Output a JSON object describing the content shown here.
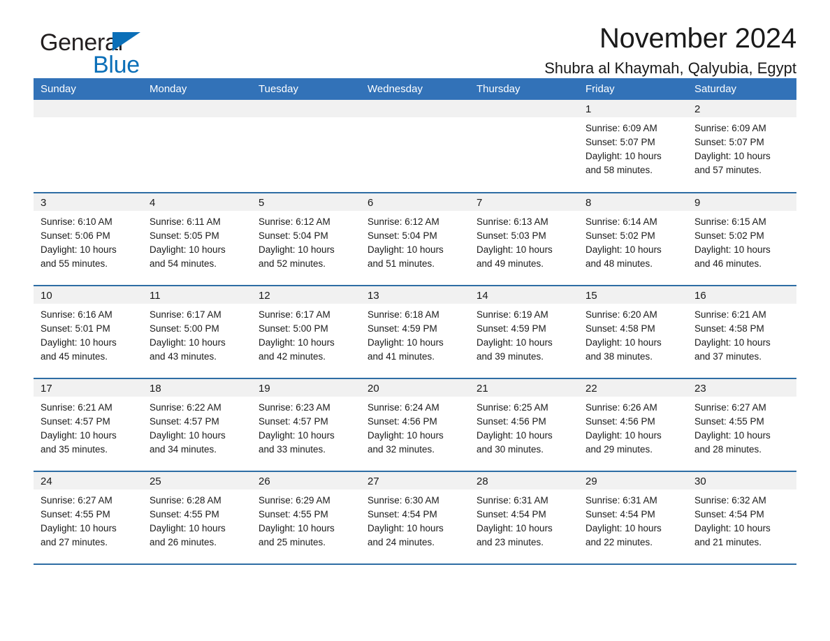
{
  "brand": {
    "word1": "General",
    "word2": "Blue",
    "triangle_color": "#0b6fb8"
  },
  "header": {
    "title": "November 2024",
    "subtitle": "Shubra al Khaymah, Qalyubia, Egypt"
  },
  "theme": {
    "header_blue": "#3272b8",
    "row_divider_blue": "#2e6da4",
    "daynum_band": "#f1f1f1",
    "text": "#1a1a1a"
  },
  "weekdays": [
    "Sunday",
    "Monday",
    "Tuesday",
    "Wednesday",
    "Thursday",
    "Friday",
    "Saturday"
  ],
  "weeks": [
    [
      {
        "day": "",
        "lines": []
      },
      {
        "day": "",
        "lines": []
      },
      {
        "day": "",
        "lines": []
      },
      {
        "day": "",
        "lines": []
      },
      {
        "day": "",
        "lines": []
      },
      {
        "day": "1",
        "sunrise": "Sunrise: 6:09 AM",
        "sunset": "Sunset: 5:07 PM",
        "daylight": "Daylight: 10 hours and 58 minutes."
      },
      {
        "day": "2",
        "sunrise": "Sunrise: 6:09 AM",
        "sunset": "Sunset: 5:07 PM",
        "daylight": "Daylight: 10 hours and 57 minutes."
      }
    ],
    [
      {
        "day": "3",
        "sunrise": "Sunrise: 6:10 AM",
        "sunset": "Sunset: 5:06 PM",
        "daylight": "Daylight: 10 hours and 55 minutes."
      },
      {
        "day": "4",
        "sunrise": "Sunrise: 6:11 AM",
        "sunset": "Sunset: 5:05 PM",
        "daylight": "Daylight: 10 hours and 54 minutes."
      },
      {
        "day": "5",
        "sunrise": "Sunrise: 6:12 AM",
        "sunset": "Sunset: 5:04 PM",
        "daylight": "Daylight: 10 hours and 52 minutes."
      },
      {
        "day": "6",
        "sunrise": "Sunrise: 6:12 AM",
        "sunset": "Sunset: 5:04 PM",
        "daylight": "Daylight: 10 hours and 51 minutes."
      },
      {
        "day": "7",
        "sunrise": "Sunrise: 6:13 AM",
        "sunset": "Sunset: 5:03 PM",
        "daylight": "Daylight: 10 hours and 49 minutes."
      },
      {
        "day": "8",
        "sunrise": "Sunrise: 6:14 AM",
        "sunset": "Sunset: 5:02 PM",
        "daylight": "Daylight: 10 hours and 48 minutes."
      },
      {
        "day": "9",
        "sunrise": "Sunrise: 6:15 AM",
        "sunset": "Sunset: 5:02 PM",
        "daylight": "Daylight: 10 hours and 46 minutes."
      }
    ],
    [
      {
        "day": "10",
        "sunrise": "Sunrise: 6:16 AM",
        "sunset": "Sunset: 5:01 PM",
        "daylight": "Daylight: 10 hours and 45 minutes."
      },
      {
        "day": "11",
        "sunrise": "Sunrise: 6:17 AM",
        "sunset": "Sunset: 5:00 PM",
        "daylight": "Daylight: 10 hours and 43 minutes."
      },
      {
        "day": "12",
        "sunrise": "Sunrise: 6:17 AM",
        "sunset": "Sunset: 5:00 PM",
        "daylight": "Daylight: 10 hours and 42 minutes."
      },
      {
        "day": "13",
        "sunrise": "Sunrise: 6:18 AM",
        "sunset": "Sunset: 4:59 PM",
        "daylight": "Daylight: 10 hours and 41 minutes."
      },
      {
        "day": "14",
        "sunrise": "Sunrise: 6:19 AM",
        "sunset": "Sunset: 4:59 PM",
        "daylight": "Daylight: 10 hours and 39 minutes."
      },
      {
        "day": "15",
        "sunrise": "Sunrise: 6:20 AM",
        "sunset": "Sunset: 4:58 PM",
        "daylight": "Daylight: 10 hours and 38 minutes."
      },
      {
        "day": "16",
        "sunrise": "Sunrise: 6:21 AM",
        "sunset": "Sunset: 4:58 PM",
        "daylight": "Daylight: 10 hours and 37 minutes."
      }
    ],
    [
      {
        "day": "17",
        "sunrise": "Sunrise: 6:21 AM",
        "sunset": "Sunset: 4:57 PM",
        "daylight": "Daylight: 10 hours and 35 minutes."
      },
      {
        "day": "18",
        "sunrise": "Sunrise: 6:22 AM",
        "sunset": "Sunset: 4:57 PM",
        "daylight": "Daylight: 10 hours and 34 minutes."
      },
      {
        "day": "19",
        "sunrise": "Sunrise: 6:23 AM",
        "sunset": "Sunset: 4:57 PM",
        "daylight": "Daylight: 10 hours and 33 minutes."
      },
      {
        "day": "20",
        "sunrise": "Sunrise: 6:24 AM",
        "sunset": "Sunset: 4:56 PM",
        "daylight": "Daylight: 10 hours and 32 minutes."
      },
      {
        "day": "21",
        "sunrise": "Sunrise: 6:25 AM",
        "sunset": "Sunset: 4:56 PM",
        "daylight": "Daylight: 10 hours and 30 minutes."
      },
      {
        "day": "22",
        "sunrise": "Sunrise: 6:26 AM",
        "sunset": "Sunset: 4:56 PM",
        "daylight": "Daylight: 10 hours and 29 minutes."
      },
      {
        "day": "23",
        "sunrise": "Sunrise: 6:27 AM",
        "sunset": "Sunset: 4:55 PM",
        "daylight": "Daylight: 10 hours and 28 minutes."
      }
    ],
    [
      {
        "day": "24",
        "sunrise": "Sunrise: 6:27 AM",
        "sunset": "Sunset: 4:55 PM",
        "daylight": "Daylight: 10 hours and 27 minutes."
      },
      {
        "day": "25",
        "sunrise": "Sunrise: 6:28 AM",
        "sunset": "Sunset: 4:55 PM",
        "daylight": "Daylight: 10 hours and 26 minutes."
      },
      {
        "day": "26",
        "sunrise": "Sunrise: 6:29 AM",
        "sunset": "Sunset: 4:55 PM",
        "daylight": "Daylight: 10 hours and 25 minutes."
      },
      {
        "day": "27",
        "sunrise": "Sunrise: 6:30 AM",
        "sunset": "Sunset: 4:54 PM",
        "daylight": "Daylight: 10 hours and 24 minutes."
      },
      {
        "day": "28",
        "sunrise": "Sunrise: 6:31 AM",
        "sunset": "Sunset: 4:54 PM",
        "daylight": "Daylight: 10 hours and 23 minutes."
      },
      {
        "day": "29",
        "sunrise": "Sunrise: 6:31 AM",
        "sunset": "Sunset: 4:54 PM",
        "daylight": "Daylight: 10 hours and 22 minutes."
      },
      {
        "day": "30",
        "sunrise": "Sunrise: 6:32 AM",
        "sunset": "Sunset: 4:54 PM",
        "daylight": "Daylight: 10 hours and 21 minutes."
      }
    ]
  ]
}
